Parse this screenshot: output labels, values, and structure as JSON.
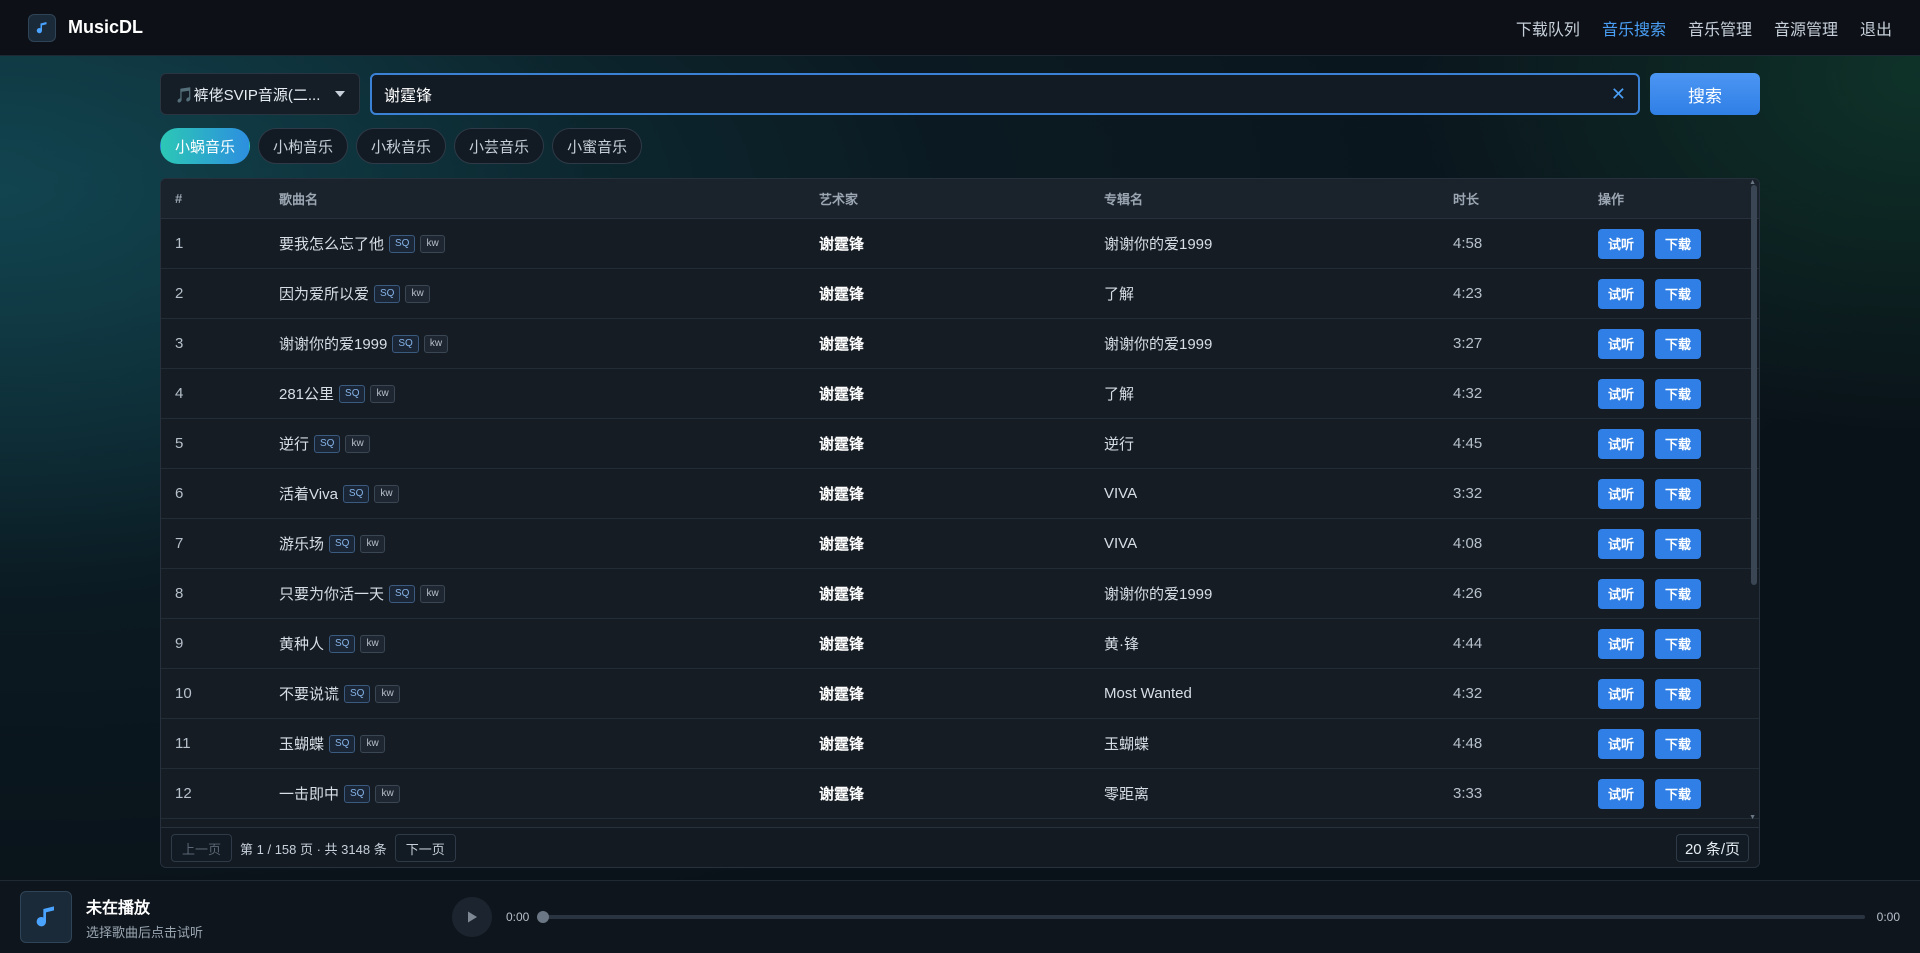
{
  "app": {
    "name": "MusicDL"
  },
  "nav": [
    {
      "label": "下载队列",
      "active": false
    },
    {
      "label": "音乐搜索",
      "active": true
    },
    {
      "label": "音乐管理",
      "active": false
    },
    {
      "label": "音源管理",
      "active": false
    },
    {
      "label": "退出",
      "active": false
    }
  ],
  "search": {
    "source": "🎵裤佬SVIP音源(二...",
    "query": "谢霆锋",
    "button": "搜索"
  },
  "platforms": [
    {
      "label": "小蜗音乐",
      "active": true
    },
    {
      "label": "小枸音乐",
      "active": false
    },
    {
      "label": "小秋音乐",
      "active": false
    },
    {
      "label": "小芸音乐",
      "active": false
    },
    {
      "label": "小蜜音乐",
      "active": false
    }
  ],
  "table": {
    "headers": {
      "idx": "#",
      "name": "歌曲名",
      "artist": "艺术家",
      "album": "专辑名",
      "duration": "时长",
      "ops": "操作"
    },
    "tags": {
      "quality": "SQ",
      "src": "kw"
    },
    "actions": {
      "preview": "试听",
      "download": "下载"
    },
    "rows": [
      {
        "idx": "1",
        "name": "要我怎么忘了他",
        "artist": "谢霆锋",
        "album": "谢谢你的爱1999",
        "duration": "4:58"
      },
      {
        "idx": "2",
        "name": "因为爱所以爱",
        "artist": "谢霆锋",
        "album": "了解",
        "duration": "4:23"
      },
      {
        "idx": "3",
        "name": "谢谢你的爱1999",
        "artist": "谢霆锋",
        "album": "谢谢你的爱1999",
        "duration": "3:27"
      },
      {
        "idx": "4",
        "name": "281公里",
        "artist": "谢霆锋",
        "album": "了解",
        "duration": "4:32"
      },
      {
        "idx": "5",
        "name": "逆行",
        "artist": "谢霆锋",
        "album": "逆行",
        "duration": "4:45"
      },
      {
        "idx": "6",
        "name": "活着Viva",
        "artist": "谢霆锋",
        "album": "VIVA",
        "duration": "3:32"
      },
      {
        "idx": "7",
        "name": "游乐场",
        "artist": "谢霆锋",
        "album": "VIVA",
        "duration": "4:08"
      },
      {
        "idx": "8",
        "name": "只要为你活一天",
        "artist": "谢霆锋",
        "album": "谢谢你的爱1999",
        "duration": "4:26"
      },
      {
        "idx": "9",
        "name": "黄种人",
        "artist": "谢霆锋",
        "album": "黄·锋",
        "duration": "4:44"
      },
      {
        "idx": "10",
        "name": "不要说谎",
        "artist": "谢霆锋",
        "album": "Most Wanted",
        "duration": "4:32"
      },
      {
        "idx": "11",
        "name": "玉蝴蝶",
        "artist": "谢霆锋",
        "album": "玉蝴蝶",
        "duration": "4:48"
      },
      {
        "idx": "12",
        "name": "一击即中",
        "artist": "谢霆锋",
        "album": "零距离",
        "duration": "3:33"
      }
    ]
  },
  "pager": {
    "prev": "上一页",
    "info": "第 1 / 158 页 · 共 3148 条",
    "next": "下一页",
    "per_page": "20 条/页"
  },
  "player": {
    "title": "未在播放",
    "subtitle": "选择歌曲后点击试听",
    "current": "0:00",
    "total": "0:00",
    "progress": 0
  }
}
